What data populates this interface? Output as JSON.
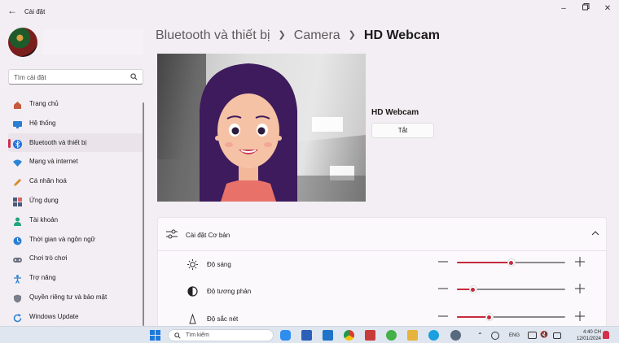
{
  "window": {
    "title": "Cài đặt"
  },
  "sidebar": {
    "search_placeholder": "Tìm cài đặt",
    "items": [
      {
        "label": "Trang chủ",
        "icon": "home-icon",
        "color": "#c55a3c"
      },
      {
        "label": "Hệ thống",
        "icon": "monitor-icon",
        "color": "#2b7fd1"
      },
      {
        "label": "Bluetooth và thiết bị",
        "icon": "bluetooth-icon",
        "color": "#1e6fd9",
        "active": true
      },
      {
        "label": "Mạng và internet",
        "icon": "wifi-icon",
        "color": "#2a85d6"
      },
      {
        "label": "Cá nhân hoá",
        "icon": "brush-icon",
        "color": "#d88a2a"
      },
      {
        "label": "Ứng dụng",
        "icon": "apps-icon",
        "color": "#4a5b7a"
      },
      {
        "label": "Tài khoản",
        "icon": "person-icon",
        "color": "#1fa67a"
      },
      {
        "label": "Thời gian và ngôn ngữ",
        "icon": "globe-clock-icon",
        "color": "#2b7fd1"
      },
      {
        "label": "Chơi trò chơi",
        "icon": "gamepad-icon",
        "color": "#6b7080"
      },
      {
        "label": "Trợ năng",
        "icon": "accessibility-icon",
        "color": "#2b7fd1"
      },
      {
        "label": "Quyền riêng tư và bảo mật",
        "icon": "shield-icon",
        "color": "#7a7f8c"
      },
      {
        "label": "Windows Update",
        "icon": "update-icon",
        "color": "#2b7fd1"
      }
    ]
  },
  "breadcrumb": {
    "items": [
      "Bluetooth và thiết bị",
      "Camera"
    ],
    "current": "HD Webcam"
  },
  "camera": {
    "name": "HD Webcam",
    "toggle_button": "Tắt"
  },
  "basic_settings": {
    "title": "Cài đặt Cơ bản",
    "rows": [
      {
        "label": "Độ sáng",
        "icon": "brightness-icon",
        "value": 0.5
      },
      {
        "label": "Độ tương phản",
        "icon": "contrast-icon",
        "value": 0.15
      },
      {
        "label": "Độ sắc nét",
        "icon": "sharpness-icon",
        "value": 0.3
      }
    ]
  },
  "taskbar": {
    "search_placeholder": "Tìm kiếm",
    "language": "ENG",
    "time": "4:40 CH",
    "date": "12/01/2024"
  },
  "colors": {
    "accent": "#c42b3e",
    "background": "#f3eef3"
  }
}
